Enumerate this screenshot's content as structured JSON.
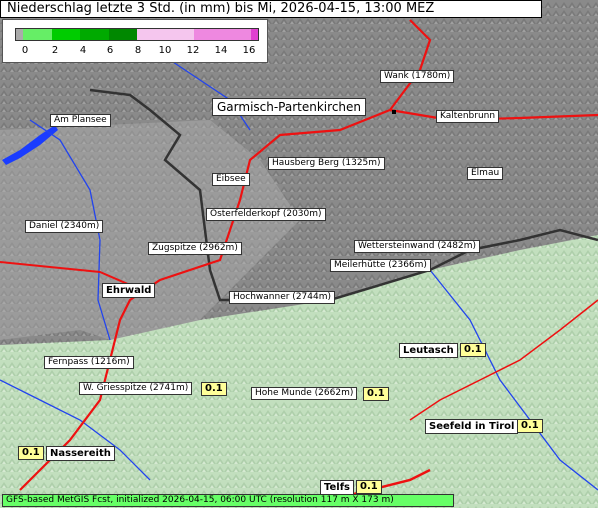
{
  "header": {
    "title": "Niederschlag letzte 3 Std. (in mm) bis Mi, 2026-04-15, 13:00 MEZ"
  },
  "legend": {
    "ticks": [
      "0",
      "2",
      "4",
      "6",
      "8",
      "10",
      "12",
      "14",
      "16"
    ],
    "colors": [
      "#aaaaaa",
      "#66ee66",
      "#00cc00",
      "#00aa00",
      "#008800",
      "#f5c6ee",
      "#f0a8e8",
      "#ee88e0",
      "#e040d0"
    ]
  },
  "places": {
    "wank": "Wank (1780m)",
    "garmisch": "Garmisch-Partenkirchen",
    "kaltenbrunn": "Kaltenbrunn",
    "am_plansee": "Am Plansee",
    "hausberg": "Hausberg Berg (1325m)",
    "eibsee": "Eibsee",
    "elmau": "Elmau",
    "osterfelderkopf": "Osterfelderkopf (2030m)",
    "daniel": "Daniel (2340m)",
    "zugspitze": "Zugspitze (2962m)",
    "wettersteinwand": "Wettersteinwand (2482m)",
    "meilerhuette": "Meilerhütte (2366m)",
    "ehrwald": "Ehrwald",
    "hochwanner": "Hochwanner (2744m)",
    "leutasch": "Leutasch",
    "fernpass": "Fernpass (1216m)",
    "griesspitze": "W. Griesspitze (2741m)",
    "hohe_munde": "Hohe Munde (2662m)",
    "seefeld": "Seefeld in Tirol",
    "nassereith": "Nassereith",
    "telfs": "Telfs"
  },
  "values": {
    "leutasch": "0.1",
    "griesspitze": "0.1",
    "hohe_munde": "0.1",
    "seefeld": "0.1",
    "nassereith": "0.1",
    "telfs": "0.1"
  },
  "footer": {
    "text": "GFS-based MetGIS Fcst, initialized 2026-04-15, 06:00 UTC (resolution 117 m X 173 m)"
  }
}
